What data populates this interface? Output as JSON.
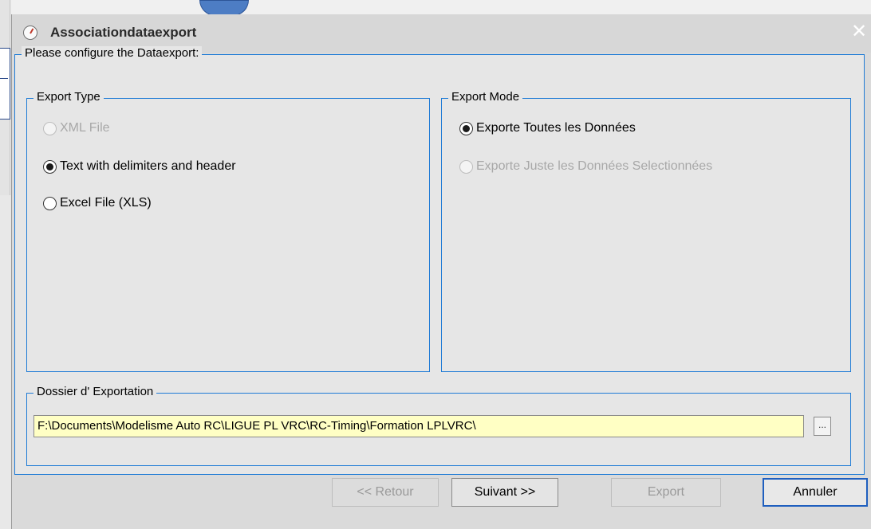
{
  "window": {
    "title": "Associationdataexport",
    "close_glyph": "✕"
  },
  "configure": {
    "legend": "Please configure the Dataexport:"
  },
  "export_type": {
    "legend": "Export Type",
    "options": [
      {
        "label": "XML File",
        "checked": false,
        "enabled": false
      },
      {
        "label": "Text with delimiters and header",
        "checked": true,
        "enabled": true
      },
      {
        "label": "Excel File (XLS)",
        "checked": false,
        "enabled": true
      }
    ]
  },
  "export_mode": {
    "legend": "Export Mode",
    "options": [
      {
        "label": "Exporte Toutes les Données",
        "checked": true,
        "enabled": true
      },
      {
        "label": "Exporte Juste les Données Selectionnées",
        "checked": false,
        "enabled": false
      }
    ]
  },
  "dossier": {
    "legend": "Dossier d' Exportation",
    "path_value": "F:\\Documents\\Modelisme Auto RC\\LIGUE PL VRC\\RC-Timing\\Formation LPLVRC\\",
    "browse_label": "..."
  },
  "buttons": {
    "back": "<< Retour",
    "next": "Suivant >>",
    "export": "Export",
    "cancel": "Annuler"
  },
  "colors": {
    "group_border": "#1f7bd6",
    "path_background": "#ffffc4",
    "default_button_border": "#1f5fbf"
  }
}
